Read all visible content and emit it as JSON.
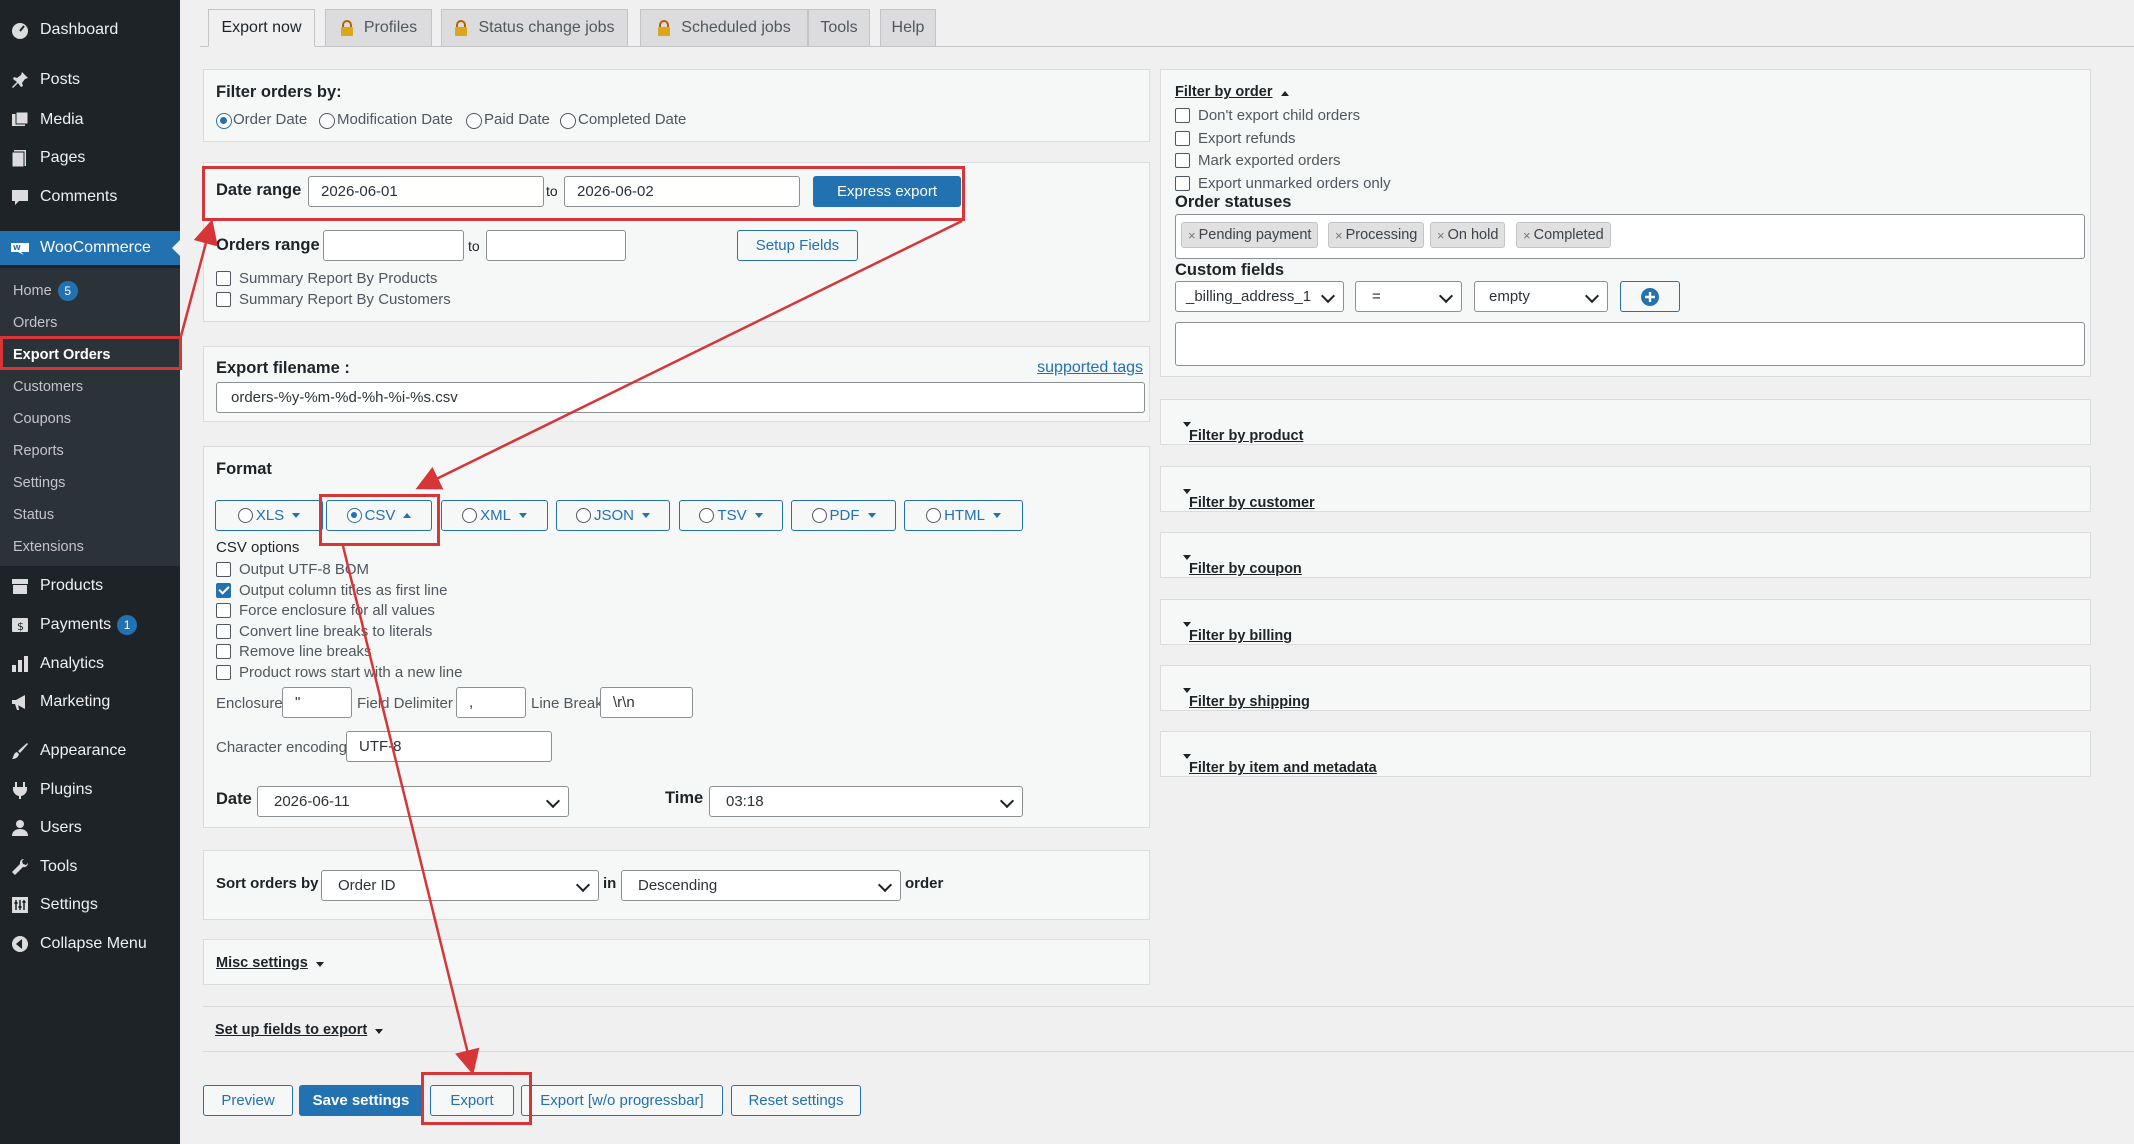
{
  "sidebar": {
    "top": [
      {
        "label": "Dashboard",
        "icon": "dashboard-icon"
      },
      {
        "label": "Posts",
        "icon": "pin-icon"
      },
      {
        "label": "Media",
        "icon": "media-icon"
      },
      {
        "label": "Pages",
        "icon": "pages-icon"
      },
      {
        "label": "Comments",
        "icon": "comment-icon"
      }
    ],
    "woocommerce": {
      "label": "WooCommerce",
      "icon": "woocommerce-icon"
    },
    "sub": [
      {
        "label": "Home",
        "badge": "5"
      },
      {
        "label": "Orders"
      },
      {
        "label": "Export Orders"
      },
      {
        "label": "Customers"
      },
      {
        "label": "Coupons"
      },
      {
        "label": "Reports"
      },
      {
        "label": "Settings"
      },
      {
        "label": "Status"
      },
      {
        "label": "Extensions"
      }
    ],
    "bottom": [
      {
        "label": "Products",
        "icon": "products-icon"
      },
      {
        "label": "Payments",
        "icon": "payments-icon",
        "badge": "1"
      },
      {
        "label": "Analytics",
        "icon": "analytics-icon"
      },
      {
        "label": "Marketing",
        "icon": "megaphone-icon"
      },
      {
        "label": "Appearance",
        "icon": "brush-icon"
      },
      {
        "label": "Plugins",
        "icon": "plugin-icon"
      },
      {
        "label": "Users",
        "icon": "user-icon"
      },
      {
        "label": "Tools",
        "icon": "wrench-icon"
      },
      {
        "label": "Settings",
        "icon": "settings-icon"
      },
      {
        "label": "Collapse Menu",
        "icon": "collapse-icon"
      }
    ]
  },
  "tabs": [
    {
      "label": "Export now",
      "locked": false
    },
    {
      "label": "Profiles",
      "locked": true
    },
    {
      "label": "Status change jobs",
      "locked": true
    },
    {
      "label": "Scheduled jobs",
      "locked": true
    },
    {
      "label": "Tools",
      "locked": false
    },
    {
      "label": "Help",
      "locked": false
    }
  ],
  "filter_by": {
    "title": "Filter orders by:",
    "options": [
      "Order Date",
      "Modification Date",
      "Paid Date",
      "Completed Date"
    ],
    "selected": "Order Date"
  },
  "date_range": {
    "label": "Date range",
    "from": "2026-06-01",
    "to_label": "to",
    "to": "2026-06-02",
    "express_button": "Express export"
  },
  "orders_range": {
    "label": "Orders range",
    "from": "",
    "to_label": "to",
    "to": "",
    "setup_button": "Setup Fields",
    "checkboxes": [
      "Summary Report By Products",
      "Summary Report By Customers"
    ]
  },
  "filename": {
    "label": "Export filename :",
    "link": "supported tags",
    "value": "orders-%y-%m-%d-%h-%i-%s.csv"
  },
  "format": {
    "label": "Format",
    "options": [
      "XLS",
      "CSV",
      "XML",
      "JSON",
      "TSV",
      "PDF",
      "HTML"
    ],
    "selected": "CSV",
    "csv_title": "CSV options",
    "csv_options": [
      {
        "label": "Output UTF-8 BOM",
        "checked": false
      },
      {
        "label": "Output column titles as first line",
        "checked": true
      },
      {
        "label": "Force enclosure for all values",
        "checked": false
      },
      {
        "label": "Convert line breaks to literals",
        "checked": false
      },
      {
        "label": "Remove line breaks",
        "checked": false
      },
      {
        "label": "Product rows start with a new line",
        "checked": false
      }
    ],
    "enclosure_label": "Enclosure",
    "enclosure": "\"",
    "delimiter_label": "Field Delimiter",
    "delimiter": ",",
    "linebreak_label": "Line Break",
    "linebreak": "\\r\\n",
    "encoding_label": "Character encoding",
    "encoding": "UTF-8"
  },
  "datetime": {
    "date_label": "Date",
    "date": "2026-06-11",
    "time_label": "Time",
    "time": "03:18"
  },
  "sort": {
    "label": "Sort orders by",
    "field": "Order ID",
    "in_label": "in",
    "direction": "Descending",
    "order_label": "order"
  },
  "misc": {
    "label": "Misc settings"
  },
  "setup_fields": {
    "label": "Set up fields to export"
  },
  "actions": {
    "preview": "Preview",
    "save": "Save settings",
    "export": "Export",
    "export_nopb": "Export [w/o progressbar]",
    "reset": "Reset settings"
  },
  "right": {
    "filter_by_order": "Filter by order",
    "order_checkboxes": [
      "Don't export child orders",
      "Export refunds",
      "Mark exported orders",
      "Export unmarked orders only"
    ],
    "order_statuses_label": "Order statuses",
    "statuses": [
      "Pending payment",
      "Processing",
      "On hold",
      "Completed"
    ],
    "custom_fields_label": "Custom fields",
    "cf_field": "_billing_address_1",
    "cf_operator": "=",
    "cf_value": "empty",
    "filters": [
      "Filter by product",
      "Filter by customer",
      "Filter by coupon",
      "Filter by billing",
      "Filter by shipping",
      "Filter by item and metadata"
    ]
  },
  "colors": {
    "accent": "#2271b1",
    "sidebar": "#1d2327",
    "annotation": "#d63638"
  }
}
